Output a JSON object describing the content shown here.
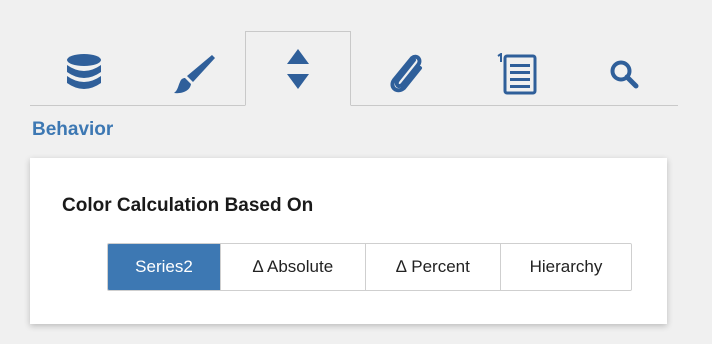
{
  "colors": {
    "accent": "#3d78b3",
    "icon": "#2f5f9a",
    "selected_text": "#ffffff"
  },
  "tabs": [
    {
      "icon": "database-icon",
      "active": false
    },
    {
      "icon": "paintbrush-icon",
      "active": false
    },
    {
      "icon": "sort-arrows-icon",
      "active": true
    },
    {
      "icon": "paperclip-icon",
      "active": false
    },
    {
      "icon": "numbered-list-icon",
      "active": false
    },
    {
      "icon": "search-icon",
      "active": false
    }
  ],
  "section": {
    "title": "Behavior"
  },
  "color_calculation": {
    "label": "Color Calculation Based On",
    "selected": "Series2",
    "options": [
      {
        "label": "Series2"
      },
      {
        "label": "∆ Absolute"
      },
      {
        "label": "∆ Percent"
      },
      {
        "label": "Hierarchy"
      }
    ]
  }
}
